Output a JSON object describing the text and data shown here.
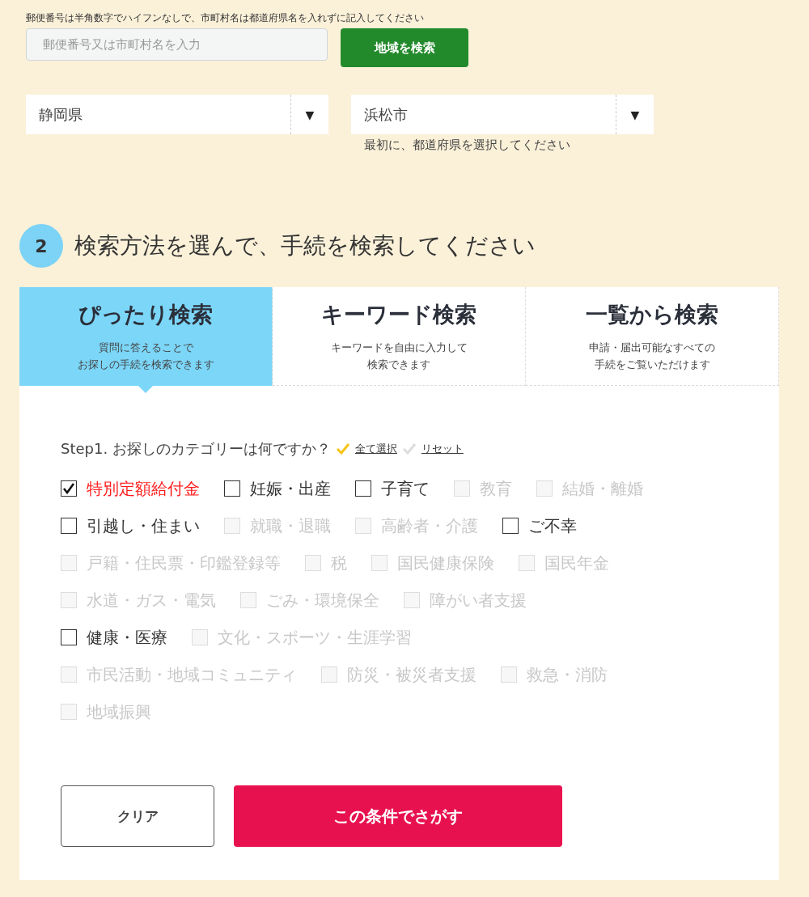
{
  "area_search": {
    "instruction": "郵便番号は半角数字でハイフンなしで、市町村名は都道府県名を入れずに記入してください",
    "placeholder": "郵便番号又は市町村名を入力",
    "button": "地域を検索"
  },
  "selects": [
    {
      "value": "静岡県",
      "arrow": "▼"
    },
    {
      "value": "浜松市",
      "arrow": "▼",
      "hint": "最初に、都道府県を選択してください"
    }
  ],
  "step2": {
    "number": "2",
    "title": "検索方法を選んで、手続を検索してください"
  },
  "tabs": [
    {
      "label": "ぴったり検索",
      "description": [
        "質問に答えることで",
        "お探しの手続を検索できます"
      ],
      "selected": true
    },
    {
      "label": "キーワード検索",
      "description": [
        "キーワードを自由に入力して",
        "検索できます"
      ],
      "selected": false
    },
    {
      "label": "一覧から検索",
      "description": [
        "申請・届出可能なすべての",
        "手続をご覧いただけます"
      ],
      "selected": false
    }
  ],
  "step1": {
    "question": "Step1. お探しのカテゴリーは何ですか？",
    "select_all": "全て選択",
    "reset": "リセット"
  },
  "category_rows": [
    [
      {
        "label": "特別定額給付金",
        "checked": true,
        "disabled": false
      },
      {
        "label": "妊娠・出産",
        "checked": false,
        "disabled": false
      },
      {
        "label": "子育て",
        "checked": false,
        "disabled": false
      },
      {
        "label": "教育",
        "checked": false,
        "disabled": true
      },
      {
        "label": "結婚・離婚",
        "checked": false,
        "disabled": true
      }
    ],
    [
      {
        "label": "引越し・住まい",
        "checked": false,
        "disabled": false
      },
      {
        "label": "就職・退職",
        "checked": false,
        "disabled": true
      },
      {
        "label": "高齢者・介護",
        "checked": false,
        "disabled": true
      },
      {
        "label": "ご不幸",
        "checked": false,
        "disabled": false
      }
    ],
    [
      {
        "label": "戸籍・住民票・印鑑登録等",
        "checked": false,
        "disabled": true
      },
      {
        "label": "税",
        "checked": false,
        "disabled": true
      },
      {
        "label": "国民健康保険",
        "checked": false,
        "disabled": true
      },
      {
        "label": "国民年金",
        "checked": false,
        "disabled": true
      }
    ],
    [
      {
        "label": "水道・ガス・電気",
        "checked": false,
        "disabled": true
      },
      {
        "label": "ごみ・環境保全",
        "checked": false,
        "disabled": true
      },
      {
        "label": "障がい者支援",
        "checked": false,
        "disabled": true
      }
    ],
    [
      {
        "label": "健康・医療",
        "checked": false,
        "disabled": false
      },
      {
        "label": "文化・スポーツ・生涯学習",
        "checked": false,
        "disabled": true
      }
    ],
    [
      {
        "label": "市民活動・地域コミュニティ",
        "checked": false,
        "disabled": true
      },
      {
        "label": "防災・被災者支援",
        "checked": false,
        "disabled": true
      },
      {
        "label": "救急・消防",
        "checked": false,
        "disabled": true
      }
    ],
    [
      {
        "label": "地域振興",
        "checked": false,
        "disabled": true
      }
    ]
  ],
  "buttons": {
    "clear": "クリア",
    "search": "この条件でさがす"
  }
}
